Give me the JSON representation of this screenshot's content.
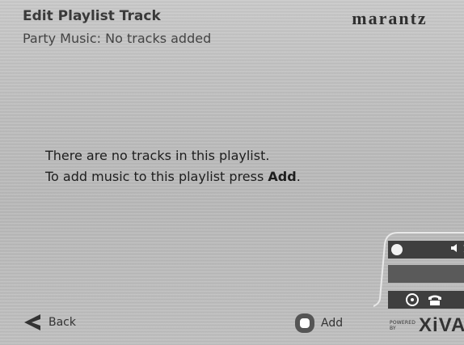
{
  "header": {
    "title": "Edit Playlist Track",
    "subtitle": "Party Music: No tracks added",
    "brand": "marantz"
  },
  "message": {
    "line1": "There are no tracks in this playlist.",
    "line2_prefix": "To add music to this playlist press ",
    "line2_action": "Add",
    "line2_suffix": "."
  },
  "status": {
    "volume_level": "1",
    "icons": [
      "power-dot-icon",
      "speaker-icon",
      "disc-icon",
      "phone-icon"
    ]
  },
  "footer": {
    "back_label": "Back",
    "add_label": "Add",
    "powered_by": "POWERED BY",
    "xiva_brand": "XiVA"
  },
  "colors": {
    "background": "#bfbfbf",
    "panel": "#3f3f3f",
    "text": "#333333"
  }
}
